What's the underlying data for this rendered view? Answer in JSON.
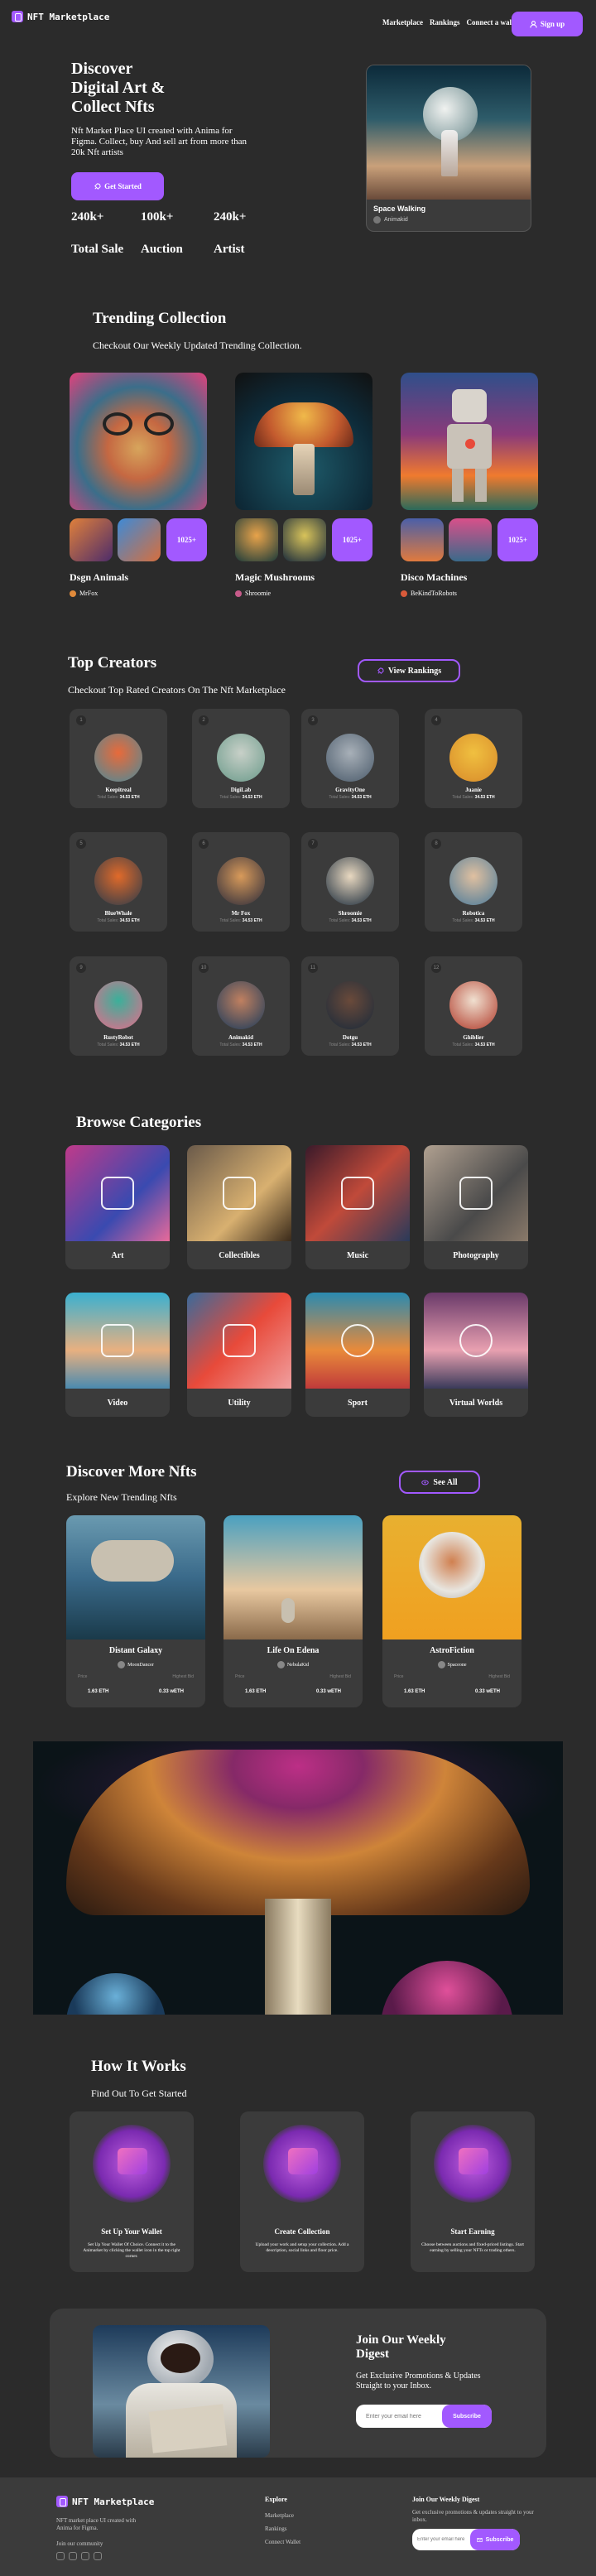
{
  "nav": {
    "logo": "NFT Marketplace",
    "links": [
      "Marketplace",
      "Rankings",
      "Connect a wallet"
    ],
    "signup": "Sign up"
  },
  "hero": {
    "title_lines": [
      "Discover",
      "Digital Art &",
      "Collect Nfts"
    ],
    "desc": "Nft Market Place UI created with Anima for Figma. Collect, buy And sell art from more than 20k Nft artists",
    "cta": "Get Started",
    "stats": [
      {
        "value": "240k+",
        "label": "Total Sale"
      },
      {
        "value": "100k+",
        "label": "Auction"
      },
      {
        "value": "240k+",
        "label": "Artist"
      }
    ],
    "card_title": "Space Walking",
    "card_artist": "Animakid"
  },
  "trending": {
    "title": "Trending Collection",
    "subtitle": "Checkout Our Weekly Updated Trending Collection.",
    "collections": [
      {
        "name": "Dsgn Animals",
        "artist": "MrFox",
        "more": "1025+"
      },
      {
        "name": "Magic Mushrooms",
        "artist": "Shroomie",
        "more": "1025+"
      },
      {
        "name": "Disco Machines",
        "artist": "BeKindToRobots",
        "more": "1025+"
      }
    ]
  },
  "creators": {
    "title": "Top Creators",
    "subtitle": "Checkout Top Rated Creators On The Nft Marketplace",
    "button": "View Rankings",
    "sales_label": "Total Sales:",
    "list": [
      {
        "rank": "1",
        "name": "Keepitreal",
        "sales": "34.53 ETH"
      },
      {
        "rank": "2",
        "name": "DigiLab",
        "sales": "34.53 ETH"
      },
      {
        "rank": "3",
        "name": "GravityOne",
        "sales": "34.53 ETH"
      },
      {
        "rank": "4",
        "name": "Juanie",
        "sales": "34.53 ETH"
      },
      {
        "rank": "5",
        "name": "BlueWhale",
        "sales": "34.53 ETH"
      },
      {
        "rank": "6",
        "name": "Mr Fox",
        "sales": "34.53 ETH"
      },
      {
        "rank": "7",
        "name": "Shroomie",
        "sales": "34.53 ETH"
      },
      {
        "rank": "8",
        "name": "Robotica",
        "sales": "34.53 ETH"
      },
      {
        "rank": "9",
        "name": "RustyRobot",
        "sales": "34.53 ETH"
      },
      {
        "rank": "10",
        "name": "Animakid",
        "sales": "34.53 ETH"
      },
      {
        "rank": "11",
        "name": "Dotgu",
        "sales": "34.53 ETH"
      },
      {
        "rank": "12",
        "name": "Ghiblier",
        "sales": "34.53 ETH"
      }
    ]
  },
  "categories": {
    "title": "Browse Categories",
    "list": [
      "Art",
      "Collectibles",
      "Music",
      "Photography",
      "Video",
      "Utility",
      "Sport",
      "Virtual Worlds"
    ]
  },
  "discover": {
    "title": "Discover More Nfts",
    "subtitle": "Explore New Trending Nfts",
    "button": "See All",
    "price_label": "Price",
    "bid_label": "Highest Bid",
    "items": [
      {
        "name": "Distant Galaxy",
        "artist": "MoonDancer",
        "price": "1.63 ETH",
        "bid": "0.33 wETH"
      },
      {
        "name": "Life On Edena",
        "artist": "NebulaKid",
        "price": "1.63 ETH",
        "bid": "0.33 wETH"
      },
      {
        "name": "AstroFiction",
        "artist": "Spaceone",
        "price": "1.63 ETH",
        "bid": "0.33 wETH"
      }
    ]
  },
  "how": {
    "title": "How It Works",
    "subtitle": "Find Out To Get Started",
    "steps": [
      {
        "title": "Set Up Your Wallet",
        "desc": "Set Up Your Wallet Of Choice. Connect it to the Animarket by clicking the wallet icon in the top right corner."
      },
      {
        "title": "Create Collection",
        "desc": "Upload your work and setup your collection. Add a description, social links and floor price."
      },
      {
        "title": "Start Earning",
        "desc": "Choose between auctions and fixed-priced listings. Start earning by selling your NFTs or trading others."
      }
    ]
  },
  "digest": {
    "title": "Join Our Weekly Digest",
    "desc": "Get Exclusive Promotions & Updates Straight to your Inbox.",
    "placeholder": "Enter your email here",
    "button": "Subscribe"
  },
  "footer": {
    "logo": "NFT Marketplace",
    "desc": "NFT market place UI created with Anima for Figma.",
    "community": "Join our community",
    "explore_title": "Explore",
    "explore_links": [
      "Marketplace",
      "Rankings",
      "Connect Wallet"
    ],
    "digest_title": "Join Our Weekly Digest",
    "digest_desc": "Get exclusive promotions & updates straight to your inbox.",
    "placeholder": "Enter your email here",
    "button": "Subscribe"
  },
  "colors": {
    "accent": "#a259ff",
    "bg": "#2b2b2b",
    "card": "#3b3b3b",
    "muted": "#858584"
  }
}
